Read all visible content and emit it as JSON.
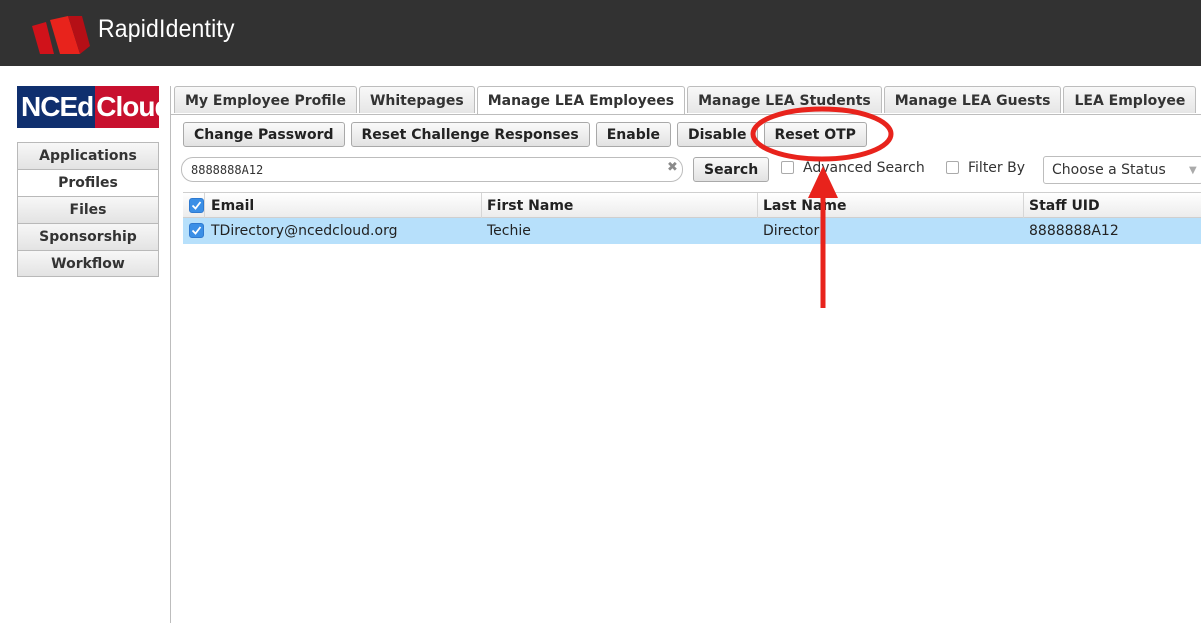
{
  "app": {
    "title": "RapidIdentity",
    "brand_nc": "NCEd",
    "brand_cloud": "Cloud"
  },
  "sidebar": {
    "items": [
      {
        "label": "Applications"
      },
      {
        "label": "Profiles"
      },
      {
        "label": "Files"
      },
      {
        "label": "Sponsorship"
      },
      {
        "label": "Workflow"
      }
    ]
  },
  "tabs": [
    {
      "label": "My Employee Profile"
    },
    {
      "label": "Whitepages"
    },
    {
      "label": "Manage LEA Employees"
    },
    {
      "label": "Manage LEA Students"
    },
    {
      "label": "Manage LEA Guests"
    },
    {
      "label": "LEA Employee"
    }
  ],
  "toolbar": {
    "change_password": "Change Password",
    "reset_challenge": "Reset Challenge Responses",
    "enable": "Enable",
    "disable": "Disable",
    "reset_otp": "Reset OTP"
  },
  "search": {
    "value": "8888888A12",
    "button": "Search",
    "advanced_label": "Advanced Search",
    "filter_label": "Filter By",
    "status_selected": "Choose a Status"
  },
  "grid": {
    "columns": [
      "Email",
      "First Name",
      "Last Name",
      "Staff UID"
    ],
    "rows": [
      {
        "email": "TDirectory@ncedcloud.org",
        "first": "Techie",
        "last": "Director",
        "uid": "8888888A12"
      }
    ]
  },
  "colors": {
    "topbar": "#323232",
    "brand_red": "#c8102e",
    "brand_blue": "#0f2f6e",
    "selected_row": "#b7e0fb",
    "annotation": "#e8231c"
  },
  "icons": [
    "logo-icon",
    "clear-icon",
    "checkbox-icon",
    "chevron-down-icon",
    "annotation-arrow"
  ]
}
